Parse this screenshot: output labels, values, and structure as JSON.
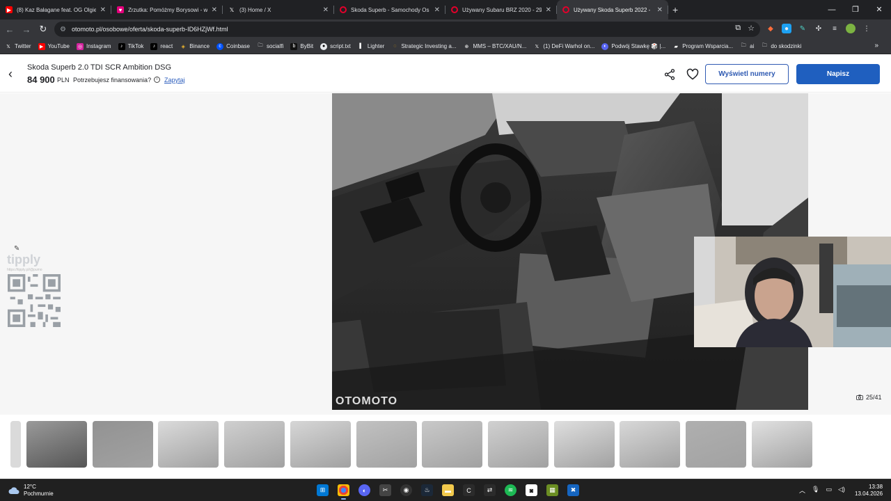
{
  "browser": {
    "tabs": [
      {
        "title": "(8) Kaz Bałagane feat. OG Olgie",
        "favicon": "youtube-icon",
        "color": "#ff0000"
      },
      {
        "title": "Zrzutka: Pomóżmy Borysowi - w",
        "favicon": "zrzutka-icon",
        "color": "#e4007c"
      },
      {
        "title": "(3) Home / X",
        "favicon": "x-icon",
        "color": "#000000"
      },
      {
        "title": "Skoda Superb - Samochody Os",
        "favicon": "otomoto-icon",
        "color": "#e4002b"
      },
      {
        "title": "Używany Subaru BRZ 2020 - 29",
        "favicon": "otomoto-icon",
        "color": "#e4002b"
      },
      {
        "title": "Używany Skoda Superb 2022 -",
        "favicon": "otomoto-icon",
        "color": "#e4002b"
      }
    ],
    "url": "otomoto.pl/osobowe/oferta/skoda-superb-ID6HZjWf.html",
    "bookmarks": [
      {
        "label": "Twitter",
        "icon": "x-icon"
      },
      {
        "label": "YouTube",
        "icon": "youtube-icon"
      },
      {
        "label": "Instagram",
        "icon": "instagram-icon"
      },
      {
        "label": "TikTok",
        "icon": "tiktok-icon"
      },
      {
        "label": "react",
        "icon": "tiktok-icon"
      },
      {
        "label": "Binance",
        "icon": "binance-icon"
      },
      {
        "label": "Coinbase",
        "icon": "coinbase-icon"
      },
      {
        "label": "socialfi",
        "icon": "folder-icon"
      },
      {
        "label": "ByBit",
        "icon": "bybit-icon"
      },
      {
        "label": "script.txt",
        "icon": "github-icon"
      },
      {
        "label": "Lighter",
        "icon": "lighter-icon"
      },
      {
        "label": "Strategic Investing a...",
        "icon": "loading-icon"
      },
      {
        "label": "MMS – BTC/XAU/N...",
        "icon": "globe-icon"
      },
      {
        "label": "(1) DeFi Warhol on...",
        "icon": "x-icon"
      },
      {
        "label": "Podwój Stawkę 🎲 |...",
        "icon": "discord-icon"
      },
      {
        "label": "Program Wsparcia...",
        "icon": "page-icon"
      },
      {
        "label": "ai",
        "icon": "folder-icon"
      },
      {
        "label": "do skodzinki",
        "icon": "folder-icon"
      }
    ]
  },
  "listing": {
    "title": "Skoda Superb 2.0 TDI SCR Ambition DSG",
    "price": "84 900",
    "currency": "PLN",
    "finance_question": "Potrzebujesz finansowania?",
    "ask_link": "Zapytaj",
    "show_numbers_button": "Wyświetl numery",
    "write_button": "Napisz"
  },
  "gallery": {
    "watermark": "OTOMOTO",
    "counter": "25/41",
    "thumbnail_count": 13,
    "selected_thumbnail": 1
  },
  "overlay": {
    "tipply_brand": "tipply",
    "tipply_url": "https://tipply.pl/@pumo"
  },
  "taskbar": {
    "temperature": "12°C",
    "weather": "Pochmurnie",
    "time": "13:38",
    "date": "13.04.2026"
  },
  "colors": {
    "primary_blue": "#1f5fbf",
    "outline_blue": "#2f5ab2",
    "link_blue": "#2d5ebd"
  }
}
